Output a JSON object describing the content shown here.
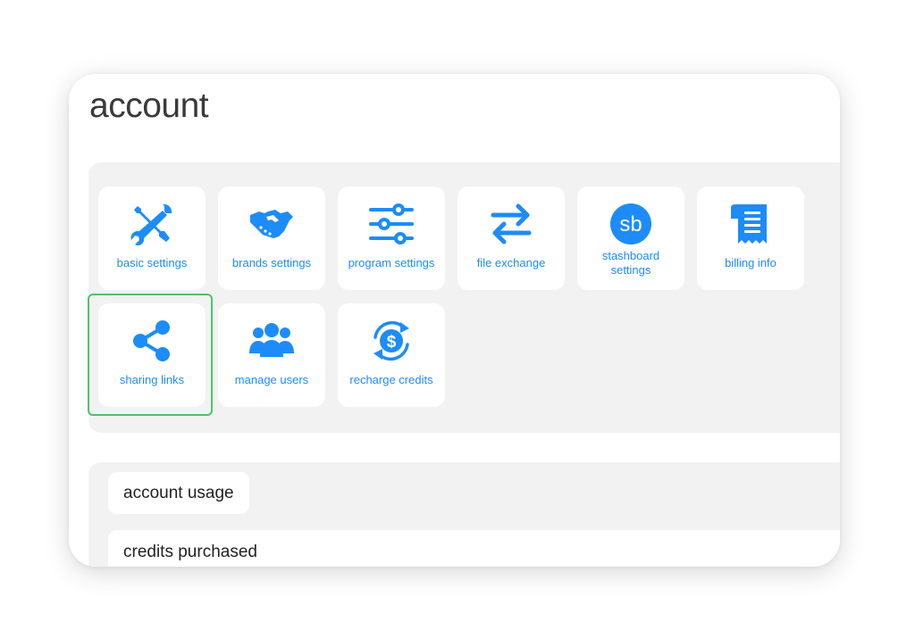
{
  "page": {
    "title": "account"
  },
  "colors": {
    "accent": "#1d8cf8",
    "selected_outline": "#4cc46a",
    "panel_bg": "#f2f2f2"
  },
  "tiles": [
    {
      "label": "basic settings",
      "icon": "tools-icon"
    },
    {
      "label": "brands settings",
      "icon": "handshake-icon"
    },
    {
      "label": "program settings",
      "icon": "sliders-icon"
    },
    {
      "label": "file exchange",
      "icon": "exchange-arrows-icon"
    },
    {
      "label": "stashboard settings",
      "icon": "sb-logo-icon"
    },
    {
      "label": "billing info",
      "icon": "receipt-icon"
    },
    {
      "label": "sharing links",
      "icon": "share-icon",
      "selected": true
    },
    {
      "label": "manage users",
      "icon": "users-icon"
    },
    {
      "label": "recharge credits",
      "icon": "recharge-dollar-icon"
    }
  ],
  "usage": {
    "heading": "account usage",
    "rows": [
      {
        "label": "credits purchased"
      }
    ]
  },
  "sb_logo_text": "sb"
}
